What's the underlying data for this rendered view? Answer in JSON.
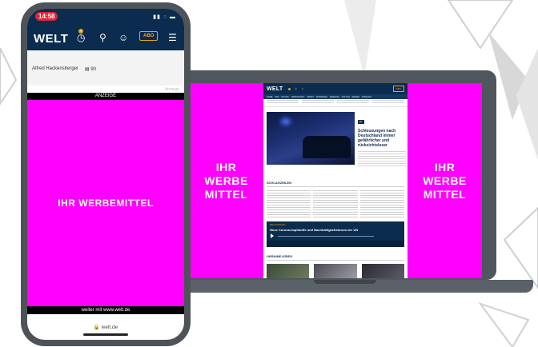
{
  "laptop": {
    "side_ad_text": "IHR\nWERBE\nMITTEL",
    "site": {
      "logo": "WELT",
      "abo_label": "ABO",
      "nav_items": [
        "HOME",
        "ZDF",
        "POLITIK",
        "WIRTSCHAFT",
        "SPORT",
        "PANORAMA",
        "MEINUNG",
        "KULTUR",
        "REISEN",
        "PODCAST"
      ],
      "badge": "EIL",
      "headline": "Schleusungen nach Deutschland immer gefährlicher und rücksichtsloser",
      "section_schlagzeilen": "SCHLAGZEILEN",
      "player_kicker": "WELT PODCAST",
      "player_title": "Neue Corona-Impfstoffe und Nachhaltigkeitsforum der UN",
      "section_ukraine": "UKRAINE-KRIEG"
    }
  },
  "phone": {
    "time": "14:58",
    "logo": "WELT",
    "notification_count": "1",
    "abo_label": "ABO",
    "author": "Alfred Hackensberger",
    "comment_count": "90",
    "anzeige_label": "Anzeige",
    "anzeige_bar": "ANZEIGE",
    "ad_text": "IHR WERBEMITTEL",
    "weiter_text": "weiter mit www.welt.de",
    "url": "welt.de"
  },
  "colors": {
    "magenta": "#ff00ff",
    "welt_navy": "#0b2c4e",
    "accent_orange": "#f0a020",
    "device_gray": "#50565d"
  },
  "icons": [
    "clock-icon",
    "search-icon",
    "user-icon",
    "menu-icon",
    "comment-icon",
    "lock-icon",
    "signal-icon",
    "wifi-icon",
    "battery-icon",
    "play-icon"
  ]
}
